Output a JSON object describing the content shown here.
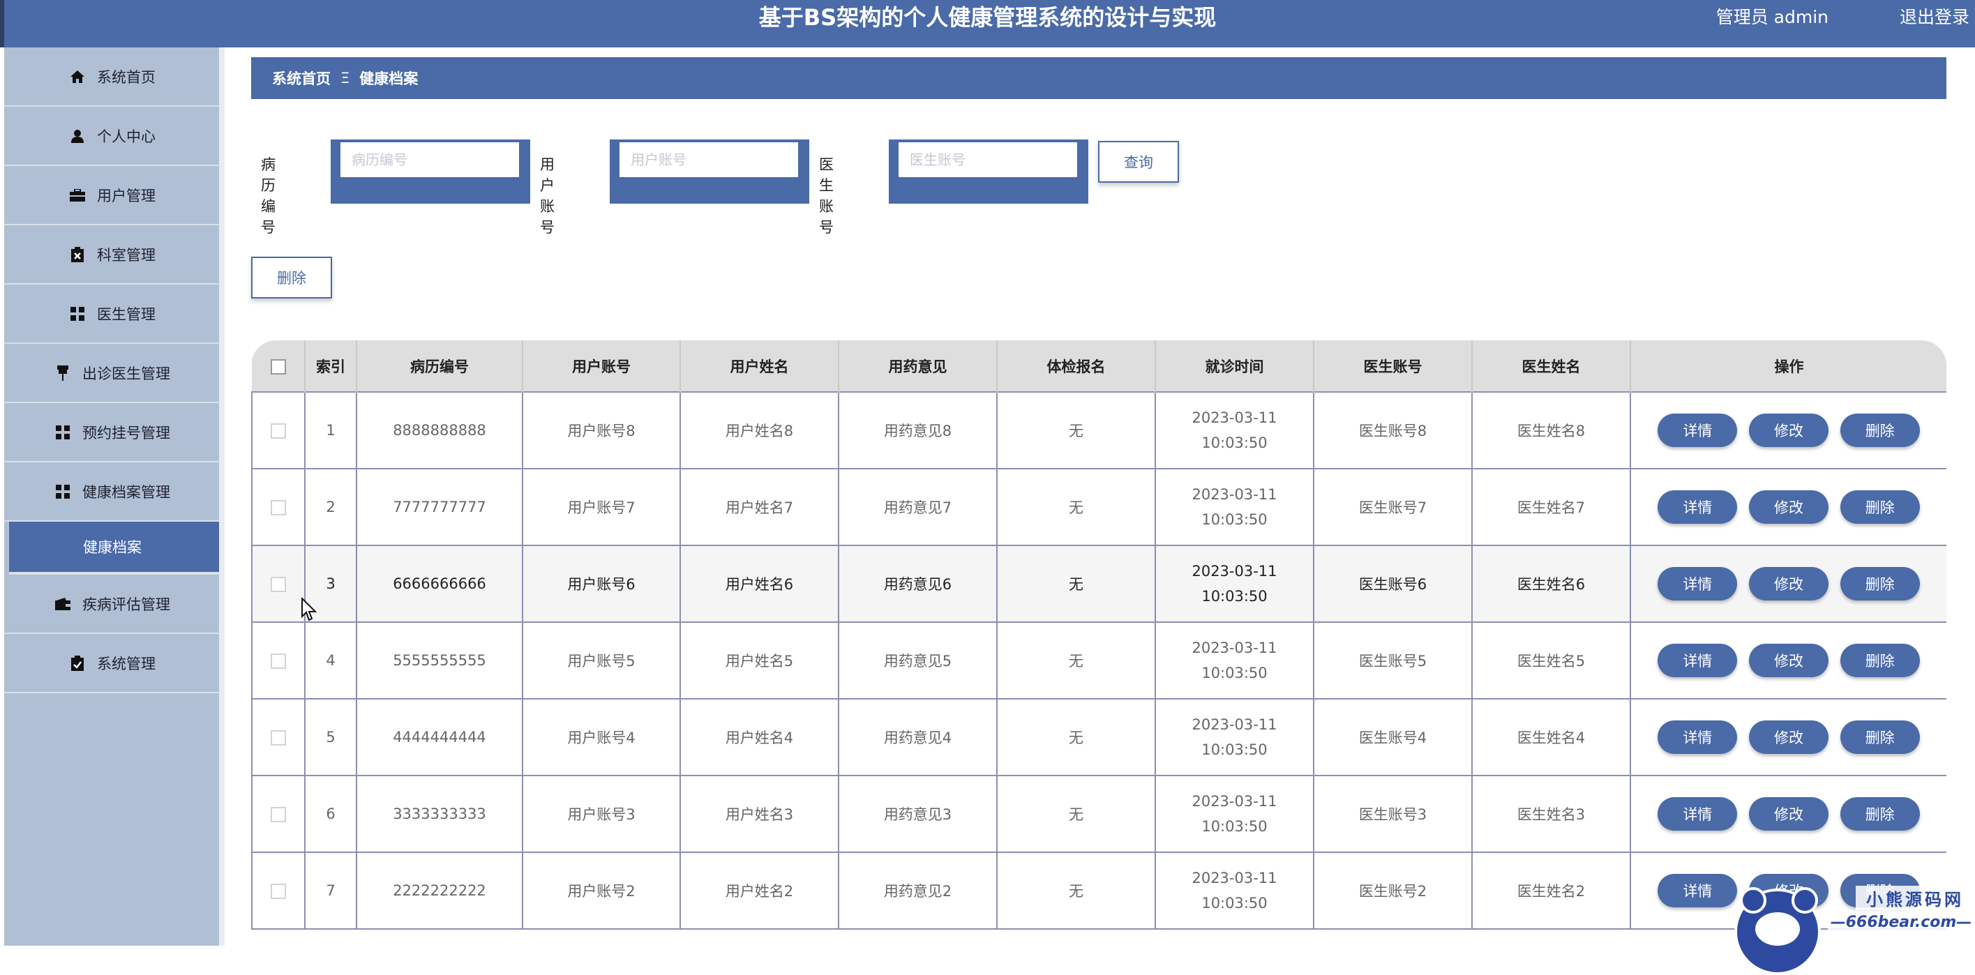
{
  "header": {
    "title": "基于BS架构的个人健康管理系统的设计与实现",
    "user": "管理员 admin",
    "logout": "退出登录"
  },
  "sidebar": {
    "items": [
      {
        "label": "系统首页",
        "icon": "home-icon"
      },
      {
        "label": "个人中心",
        "icon": "user-icon"
      },
      {
        "label": "用户管理",
        "icon": "briefcase-icon"
      },
      {
        "label": "科室管理",
        "icon": "clipboard-x-icon"
      },
      {
        "label": "医生管理",
        "icon": "grid-icon"
      },
      {
        "label": "出诊医生管理",
        "icon": "pin-icon"
      },
      {
        "label": "预约挂号管理",
        "icon": "grid-icon"
      },
      {
        "label": "健康档案管理",
        "icon": "grid-icon"
      },
      {
        "label": "健康档案",
        "sub": true
      },
      {
        "label": "疾病评估管理",
        "icon": "wallet-icon"
      },
      {
        "label": "系统管理",
        "icon": "clipboard-check-icon"
      }
    ]
  },
  "breadcrumb": {
    "home": "系统首页",
    "separator": "Ξ",
    "current": "健康档案"
  },
  "search": {
    "fields": [
      {
        "label": "病历编号",
        "placeholder": "病历编号"
      },
      {
        "label": "用户账号",
        "placeholder": "用户账号"
      },
      {
        "label": "医生账号",
        "placeholder": "医生账号"
      }
    ],
    "query_label": "查询"
  },
  "toolbar": {
    "delete_label": "删除"
  },
  "table": {
    "columns": [
      "索引",
      "病历编号",
      "用户账号",
      "用户姓名",
      "用药意见",
      "体检报名",
      "就诊时间",
      "医生账号",
      "医生姓名",
      "操作"
    ],
    "actions": {
      "detail": "详情",
      "edit": "修改",
      "delete": "删除"
    },
    "rows": [
      {
        "index": "1",
        "record_no": "8888888888",
        "user_account": "用户账号8",
        "user_name": "用户姓名8",
        "medication": "用药意见8",
        "exam": "无",
        "visit_time": "2023-03-11 10:03:50",
        "doctor_account": "医生账号8",
        "doctor_name": "医生姓名8"
      },
      {
        "index": "2",
        "record_no": "7777777777",
        "user_account": "用户账号7",
        "user_name": "用户姓名7",
        "medication": "用药意见7",
        "exam": "无",
        "visit_time": "2023-03-11 10:03:50",
        "doctor_account": "医生账号7",
        "doctor_name": "医生姓名7"
      },
      {
        "index": "3",
        "record_no": "6666666666",
        "user_account": "用户账号6",
        "user_name": "用户姓名6",
        "medication": "用药意见6",
        "exam": "无",
        "visit_time": "2023-03-11 10:03:50",
        "doctor_account": "医生账号6",
        "doctor_name": "医生姓名6"
      },
      {
        "index": "4",
        "record_no": "5555555555",
        "user_account": "用户账号5",
        "user_name": "用户姓名5",
        "medication": "用药意见5",
        "exam": "无",
        "visit_time": "2023-03-11 10:03:50",
        "doctor_account": "医生账号5",
        "doctor_name": "医生姓名5"
      },
      {
        "index": "5",
        "record_no": "4444444444",
        "user_account": "用户账号4",
        "user_name": "用户姓名4",
        "medication": "用药意见4",
        "exam": "无",
        "visit_time": "2023-03-11 10:03:50",
        "doctor_account": "医生账号4",
        "doctor_name": "医生姓名4"
      },
      {
        "index": "6",
        "record_no": "3333333333",
        "user_account": "用户账号3",
        "user_name": "用户姓名3",
        "medication": "用药意见3",
        "exam": "无",
        "visit_time": "2023-03-11 10:03:50",
        "doctor_account": "医生账号3",
        "doctor_name": "医生姓名3"
      },
      {
        "index": "7",
        "record_no": "2222222222",
        "user_account": "用户账号2",
        "user_name": "用户姓名2",
        "medication": "用药意见2",
        "exam": "无",
        "visit_time": "2023-03-11 10:03:50",
        "doctor_account": "医生账号2",
        "doctor_name": "医生姓名2"
      }
    ]
  },
  "watermark": {
    "line1": "小熊源码网",
    "line2": "—666bear.com—"
  }
}
